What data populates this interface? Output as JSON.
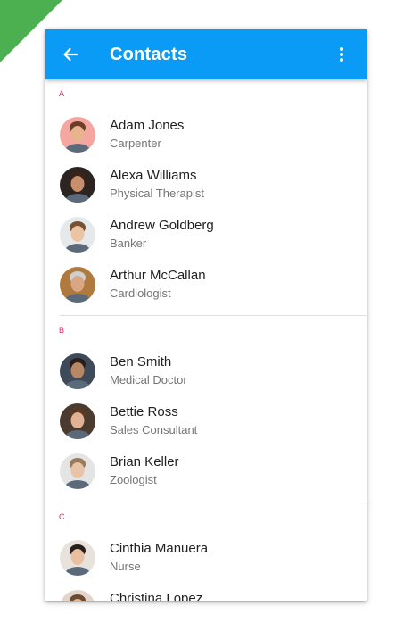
{
  "theme": {
    "appbar_color": "#0A9BF7",
    "section_letter_color": "#E91E63",
    "ribbon_color": "#4CAF50"
  },
  "appbar": {
    "title": "Contacts",
    "back_icon": "arrow-left-icon",
    "more_icon": "more-vert-icon"
  },
  "sections": [
    {
      "letter": "A",
      "contacts": [
        {
          "name": "Adam Jones",
          "role": "Carpenter",
          "avatar_bg": "#F4A6A0",
          "skin": "#E8B48E",
          "hair": "#6B3E26"
        },
        {
          "name": "Alexa Williams",
          "role": "Physical Therapist",
          "avatar_bg": "#2B2420",
          "skin": "#C98E6C",
          "hair": "#3A2418"
        },
        {
          "name": "Andrew Goldberg",
          "role": "Banker",
          "avatar_bg": "#E6E9EC",
          "skin": "#EBC4A4",
          "hair": "#7A5030"
        },
        {
          "name": "Arthur McCallan",
          "role": "Cardiologist",
          "avatar_bg": "#B07A3E",
          "skin": "#D9A783",
          "hair": "#CFCFCF"
        }
      ]
    },
    {
      "letter": "B",
      "contacts": [
        {
          "name": "Ben Smith",
          "role": "Medical Doctor",
          "avatar_bg": "#3E4A5A",
          "skin": "#B88866",
          "hair": "#2A1E18"
        },
        {
          "name": "Bettie Ross",
          "role": "Sales Consultant",
          "avatar_bg": "#4A3A30",
          "skin": "#E2B294",
          "hair": "#5A3A22"
        },
        {
          "name": "Brian Keller",
          "role": "Zoologist",
          "avatar_bg": "#E4E4E4",
          "skin": "#E8C3A6",
          "hair": "#9A7A5A"
        }
      ]
    },
    {
      "letter": "C",
      "contacts": [
        {
          "name": "Cinthia Manuera",
          "role": "Nurse",
          "avatar_bg": "#E8E2DC",
          "skin": "#E9BFA0",
          "hair": "#2A1E1A"
        },
        {
          "name": "Christina Lopez",
          "role": "",
          "avatar_bg": "#E2D6CA",
          "skin": "#E4B898",
          "hair": "#6A4A30"
        }
      ]
    }
  ]
}
